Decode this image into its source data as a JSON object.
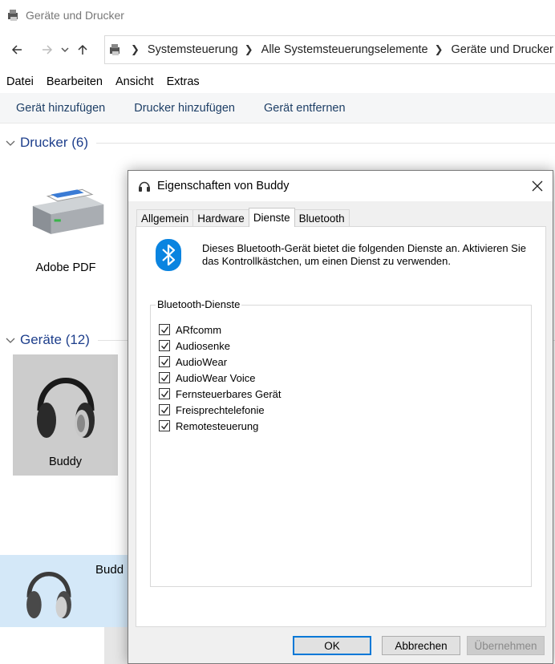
{
  "window": {
    "title": "Geräte und Drucker",
    "breadcrumb": [
      "Systemsteuerung",
      "Alle Systemsteuerungselemente",
      "Geräte und Drucker"
    ],
    "nav_icons": [
      "back-arrow-icon",
      "forward-arrow-icon",
      "recent-dropdown-icon",
      "up-arrow-icon"
    ]
  },
  "menu": [
    "Datei",
    "Bearbeiten",
    "Ansicht",
    "Extras"
  ],
  "commands": [
    "Gerät hinzufügen",
    "Drucker hinzufügen",
    "Gerät entfernen"
  ],
  "groups": {
    "printers": {
      "label": "Drucker (6)",
      "items": [
        {
          "label": "Adobe PDF",
          "icon": "printer-icon"
        }
      ]
    },
    "devices": {
      "label": "Geräte (12)",
      "items": [
        {
          "label": "Buddy",
          "icon": "headphones-icon",
          "selected": true
        }
      ]
    }
  },
  "drag_label": "Budd",
  "dialog": {
    "title": "Eigenschaften von Buddy",
    "tabs": [
      "Allgemein",
      "Hardware",
      "Dienste",
      "Bluetooth"
    ],
    "active_tab": "Dienste",
    "intro": "Dieses Bluetooth-Gerät bietet die folgenden Dienste an. Aktivieren Sie das Kontrollkästchen, um einen Dienst zu verwenden.",
    "services_label": "Bluetooth-Dienste",
    "services": [
      {
        "label": "ARfcomm",
        "checked": true
      },
      {
        "label": "Audiosenke",
        "checked": true
      },
      {
        "label": "AudioWear",
        "checked": true
      },
      {
        "label": "AudioWear Voice",
        "checked": true
      },
      {
        "label": "Fernsteuerbares Gerät",
        "checked": true
      },
      {
        "label": "Freisprechtelefonie",
        "checked": true
      },
      {
        "label": "Remotesteuerung",
        "checked": true
      }
    ],
    "buttons": {
      "ok": "OK",
      "cancel": "Abbrechen",
      "apply": "Übernehmen"
    }
  },
  "colors": {
    "link_blue": "#1e3f8c",
    "bluetooth": "#0a84e0",
    "ok_border": "#0078d7"
  }
}
